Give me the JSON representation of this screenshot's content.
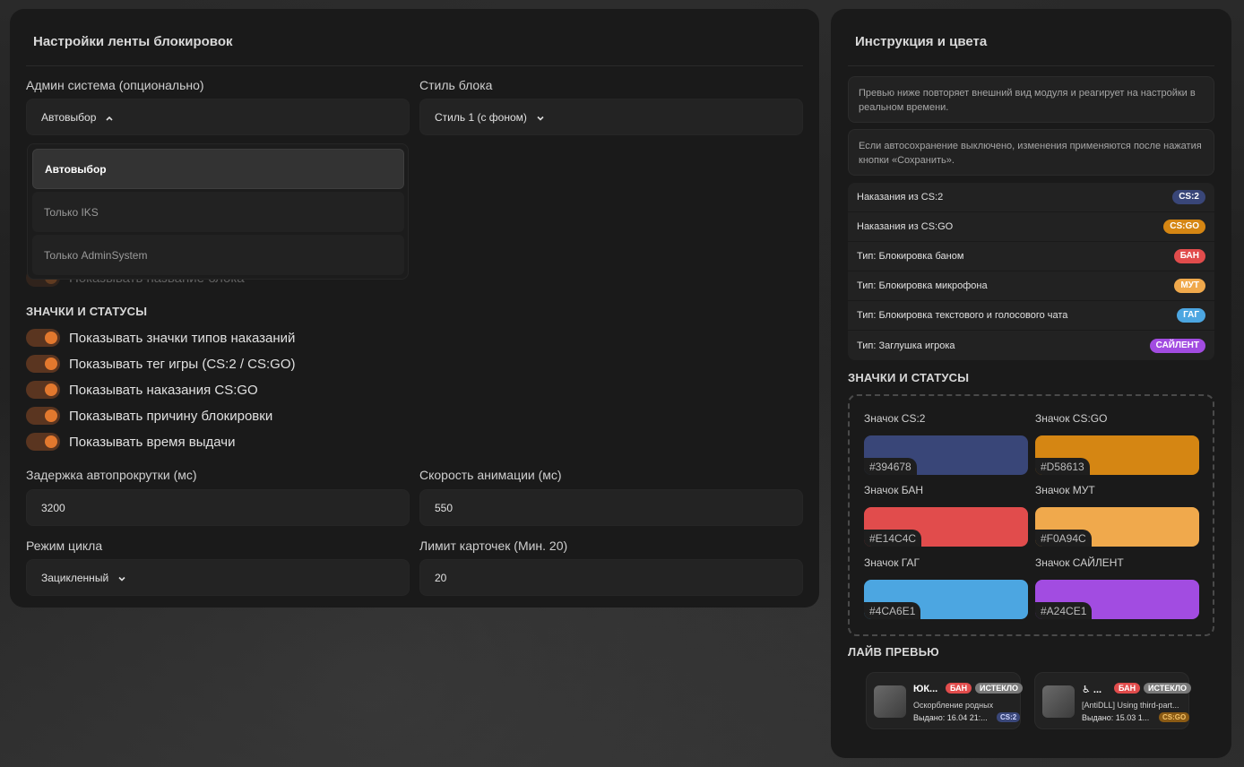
{
  "left": {
    "title": "Настройки ленты блокировок",
    "admin_label": "Админ система (опционально)",
    "admin_value": "Автовыбор",
    "style_label": "Стиль блока",
    "style_value": "Стиль 1 (с фоном)",
    "dropdown_options": [
      "Автовыбор",
      "Только IKS",
      "Только AdminSystem"
    ],
    "hidden_toggle_label": "Показывать название блока",
    "badges_section": "ЗНАЧКИ И СТАТУСЫ",
    "toggles": [
      "Показывать значки типов наказаний",
      "Показывать тег игры (CS:2 / CS:GO)",
      "Показывать наказания CS:GO",
      "Показывать причину блокировки",
      "Показывать время выдачи"
    ],
    "scroll_delay_label": "Задержка автопрокрутки (мс)",
    "scroll_delay_value": "3200",
    "anim_speed_label": "Скорость анимации (мс)",
    "anim_speed_value": "550",
    "loop_label": "Режим цикла",
    "loop_value": "Зацикленный",
    "card_limit_label": "Лимит карточек (Мин. 20)",
    "card_limit_value": "20"
  },
  "right": {
    "title": "Инструкция и цвета",
    "info1": "Превью ниже повторяет внешний вид модуля и реагирует на настройки в реальном времени.",
    "info2": "Если автосохранение выключено, изменения применяются после нажатия кнопки «Сохранить».",
    "legend": [
      {
        "label": "Наказания из CS:2",
        "badge": "CS:2",
        "color": "#394678"
      },
      {
        "label": "Наказания из CS:GO",
        "badge": "CS:GO",
        "color": "#D58613"
      },
      {
        "label": "Тип: Блокировка баном",
        "badge": "БАН",
        "color": "#E14C4C"
      },
      {
        "label": "Тип: Блокировка микрофона",
        "badge": "МУТ",
        "color": "#F0A94C"
      },
      {
        "label": "Тип: Блокировка текстового и голосового чата",
        "badge": "ГАГ",
        "color": "#4CA6E1"
      },
      {
        "label": "Тип: Заглушка игрока",
        "badge": "САЙЛЕНТ",
        "color": "#A24CE1"
      }
    ],
    "badges_section": "ЗНАЧКИ И СТАТУСЫ",
    "swatches": [
      {
        "label": "Значок CS:2",
        "hex": "#394678"
      },
      {
        "label": "Значок CS:GO",
        "hex": "#D58613"
      },
      {
        "label": "Значок БАН",
        "hex": "#E14C4C"
      },
      {
        "label": "Значок МУТ",
        "hex": "#F0A94C"
      },
      {
        "label": "Значок ГАГ",
        "hex": "#4CA6E1"
      },
      {
        "label": "Значок САЙЛЕНТ",
        "hex": "#A24CE1"
      }
    ],
    "live_section": "ЛАЙВ ПРЕВЬЮ",
    "live_cards": [
      {
        "name": "ЮК...",
        "type": "БАН",
        "status": "ИСТЕКЛО",
        "reason": "Оскорбление родных",
        "date": "Выдано: 16.04 21:...",
        "game": "CS:2"
      },
      {
        "name": "♿ ...",
        "type": "БАН",
        "status": "ИСТЕКЛО",
        "reason": "[AntiDLL] Using third-part...",
        "date": "Выдано: 15.03 1...",
        "game": "CS:GO"
      }
    ]
  }
}
